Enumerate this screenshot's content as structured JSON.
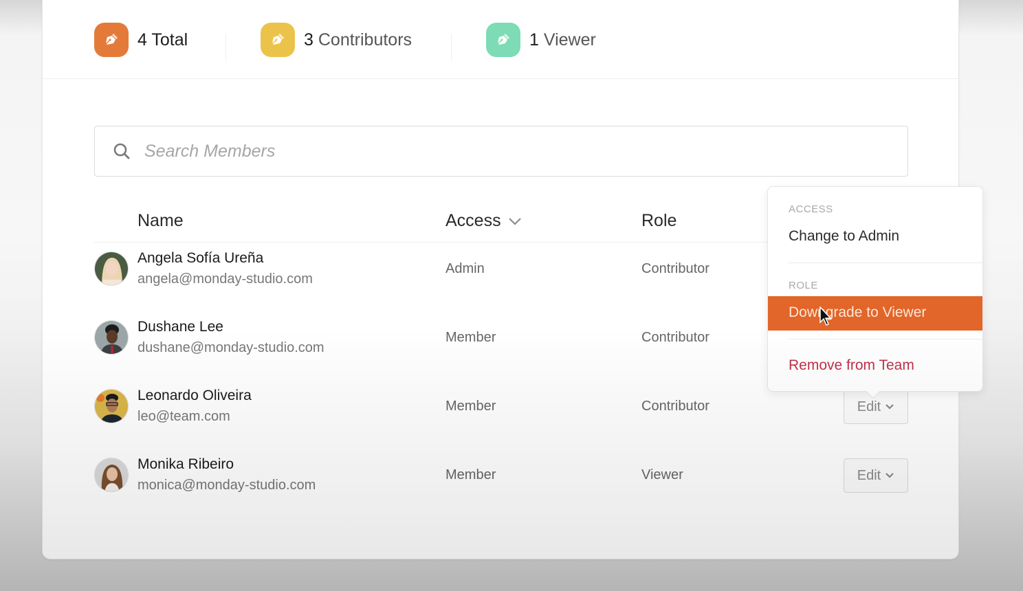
{
  "stats": [
    {
      "icon": "pen-nib-icon",
      "count": "4",
      "label": "Total",
      "color": "#e47a3a"
    },
    {
      "icon": "pen-nib-icon",
      "count": "3",
      "label": "Contributors",
      "color": "#ecc34a"
    },
    {
      "icon": "pen-nib-icon",
      "count": "1",
      "label": "Viewer",
      "color": "#7ddcb5"
    }
  ],
  "search": {
    "placeholder": "Search Members",
    "value": ""
  },
  "table": {
    "headers": {
      "name": "Name",
      "access": "Access",
      "role": "Role"
    },
    "rows": [
      {
        "name": "Angela Sofía Ureña",
        "email": "angela@monday-studio.com",
        "access": "Admin",
        "role": "Contributor",
        "edit": ""
      },
      {
        "name": "Dushane Lee",
        "email": "dushane@monday-studio.com",
        "access": "Member",
        "role": "Contributor",
        "edit": ""
      },
      {
        "name": "Leonardo Oliveira",
        "email": "leo@team.com",
        "access": "Member",
        "role": "Contributor",
        "edit": "Edit"
      },
      {
        "name": "Monika Ribeiro",
        "email": "monica@monday-studio.com",
        "access": "Member",
        "role": "Viewer",
        "edit": "Edit"
      }
    ]
  },
  "menu": {
    "access_section": "ACCESS",
    "change_to_admin": "Change to Admin",
    "role_section": "ROLE",
    "downgrade_to_viewer": "Downgrade to Viewer",
    "remove_from_team": "Remove from Team",
    "highlight_color": "#e2652a",
    "danger_color": "#c2304a"
  }
}
